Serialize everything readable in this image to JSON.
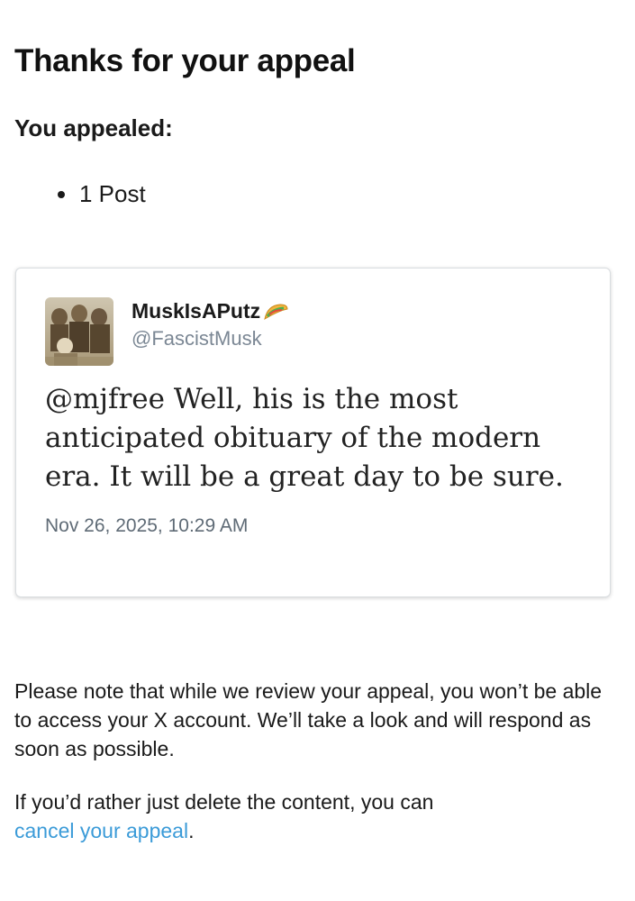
{
  "header": {
    "title": "Thanks for your appeal",
    "subtitle": "You appealed:"
  },
  "appealed_items": [
    {
      "label": "1 Post"
    }
  ],
  "post": {
    "display_name": "MuskIsAPutz",
    "name_emoji_icon": "taco-icon",
    "handle": "@FascistMusk",
    "text": "@mjfree Well, his is the most anticipated obituary of the modern era. It will be a great day to be sure.",
    "timestamp": "Nov 26, 2025, 10:29 AM"
  },
  "note": {
    "review_text": "Please note that while we review your appeal, you won’t be able to access your X account. We’ll take a look and will respond as soon as possible.",
    "cancel_prefix": "If you’d rather just delete the content, you can ",
    "cancel_link": "cancel your appeal",
    "cancel_suffix": "."
  },
  "colors": {
    "link": "#3b9bd8",
    "handle": "#7b8794",
    "card_border": "#d9dde0"
  }
}
